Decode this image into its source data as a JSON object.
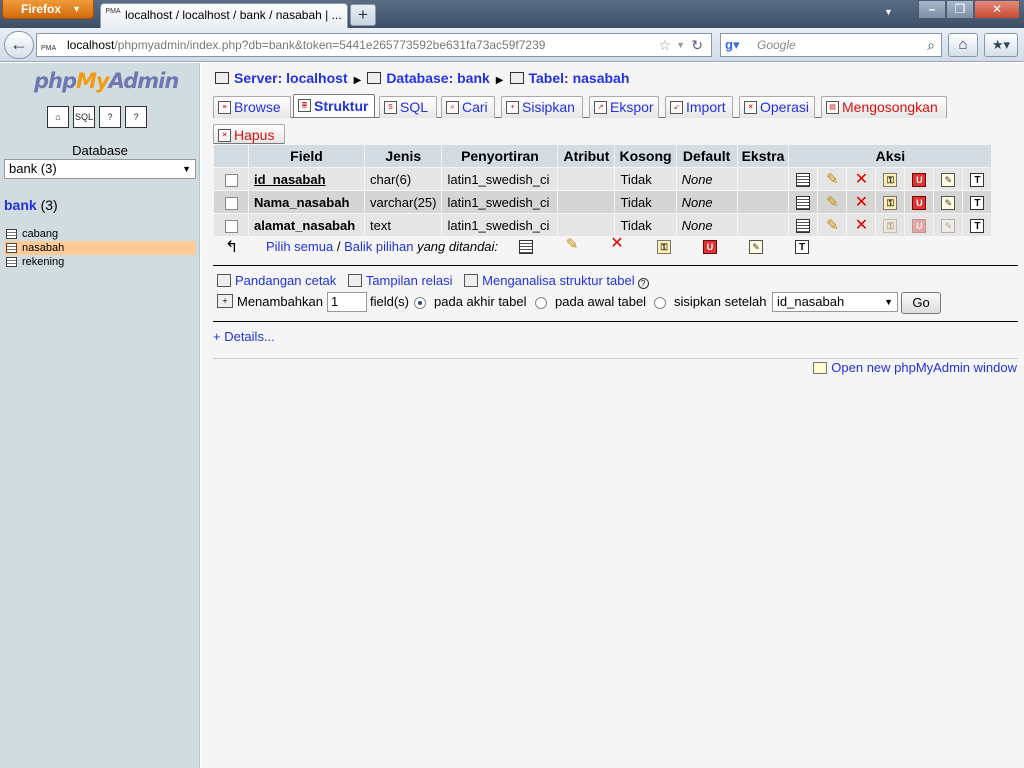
{
  "browser": {
    "menu_button": "Firefox",
    "tab_title": "localhost / localhost / bank / nasabah | ...",
    "tab_favicon": "PMA",
    "url_host": "localhost",
    "url_path": "/phpmyadmin/index.php?db=bank&token=5441e265773592be631fa73ac59f7239",
    "search_placeholder": "Google"
  },
  "sidebar": {
    "logo_php": "php",
    "logo_my": "My",
    "logo_admin": "Admin",
    "database_label": "Database",
    "database_selected": "bank (3)",
    "db_name": "bank",
    "db_count": "(3)",
    "tables": [
      {
        "name": "cabang",
        "active": false
      },
      {
        "name": "nasabah",
        "active": true
      },
      {
        "name": "rekening",
        "active": false
      }
    ]
  },
  "breadcrumb": {
    "server": "Server: localhost",
    "database": "Database: bank",
    "table": "Tabel: nasabah"
  },
  "tabs": [
    {
      "label": "Browse",
      "icon": "browse-icon"
    },
    {
      "label": "Struktur",
      "icon": "structure-icon",
      "active": true
    },
    {
      "label": "SQL",
      "icon": "sql-icon"
    },
    {
      "label": "Cari",
      "icon": "search-icon"
    },
    {
      "label": "Sisipkan",
      "icon": "insert-icon"
    },
    {
      "label": "Ekspor",
      "icon": "export-icon"
    },
    {
      "label": "Import",
      "icon": "import-icon"
    },
    {
      "label": "Operasi",
      "icon": "operations-icon"
    },
    {
      "label": "Mengosongkan",
      "icon": "empty-icon"
    },
    {
      "label": "Hapus",
      "icon": "drop-icon"
    }
  ],
  "table": {
    "headers": [
      "Field",
      "Jenis",
      "Penyortiran",
      "Atribut",
      "Kosong",
      "Default",
      "Ekstra",
      "Aksi"
    ],
    "rows": [
      {
        "field": "id_nasabah",
        "type": "char(6)",
        "collation": "latin1_swedish_ci",
        "attribute": "",
        "null": "Tidak",
        "default": "None",
        "extra": "",
        "primary": true
      },
      {
        "field": "Nama_nasabah",
        "type": "varchar(25)",
        "collation": "latin1_swedish_ci",
        "attribute": "",
        "null": "Tidak",
        "default": "None",
        "extra": "",
        "primary": false
      },
      {
        "field": "alamat_nasabah",
        "type": "text",
        "collation": "latin1_swedish_ci",
        "attribute": "",
        "null": "Tidak",
        "default": "None",
        "extra": "",
        "primary": false
      }
    ]
  },
  "with_selected": {
    "check_all": "Pilih semua",
    "separator": "/",
    "uncheck_all": "Balik pilihan",
    "label": "yang ditandai:"
  },
  "links": {
    "print_view": "Pandangan cetak",
    "relation_view": "Tampilan relasi",
    "propose_structure": "Menganalisa struktur tabel"
  },
  "add_field": {
    "label": "Menambahkan",
    "count": "1",
    "suffix": "field(s)",
    "at_end": "pada akhir tabel",
    "at_beginning": "pada awal tabel",
    "after": "sisipkan setelah",
    "after_field": "id_nasabah",
    "go": "Go"
  },
  "details": "+ Details...",
  "new_window": "Open new phpMyAdmin window"
}
